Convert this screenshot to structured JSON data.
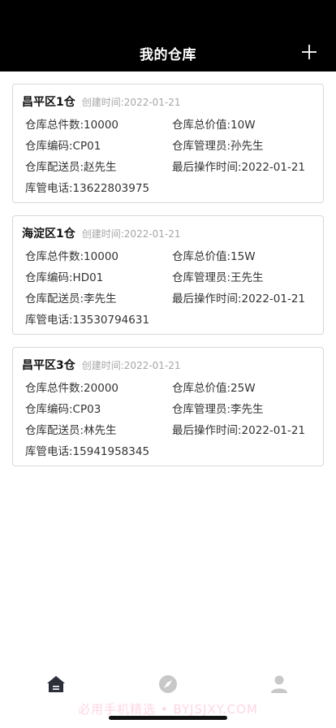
{
  "header": {
    "title": "我的仓库"
  },
  "warehouses": [
    {
      "name": "昌平区1仓",
      "created": "创建时间:2022-01-21",
      "total_items": "仓库总件数:10000",
      "total_value": "仓库总价值:10W",
      "code": "仓库编码:CP01",
      "manager": "仓库管理员:孙先生",
      "courier": "仓库配送员:赵先生",
      "last_op": "最后操作时间:2022-01-21",
      "phone": "库管电话:13622803975"
    },
    {
      "name": "海淀区1仓",
      "created": "创建时间:2022-01-21",
      "total_items": "仓库总件数:10000",
      "total_value": "仓库总价值:15W",
      "code": "仓库编码:HD01",
      "manager": "仓库管理员:王先生",
      "courier": "仓库配送员:李先生",
      "last_op": "最后操作时间:2022-01-21",
      "phone": "库管电话:13530794631"
    },
    {
      "name": "昌平区3仓",
      "created": "创建时间:2022-01-21",
      "total_items": "仓库总件数:20000",
      "total_value": "仓库总价值:25W",
      "code": "仓库编码:CP03",
      "manager": "仓库管理员:李先生",
      "courier": "仓库配送员:林先生",
      "last_op": "最后操作时间:2022-01-21",
      "phone": "库管电话:15941958345"
    }
  ],
  "tabbar": {
    "items": [
      {
        "icon": "home-icon",
        "active": true
      },
      {
        "icon": "compass-icon",
        "active": false
      },
      {
        "icon": "user-icon",
        "active": false
      }
    ],
    "active_color": "#2b2f3a",
    "inactive_color": "#c8c8c8"
  },
  "watermark": "必用手机精选 • BYJSJXY.COM"
}
